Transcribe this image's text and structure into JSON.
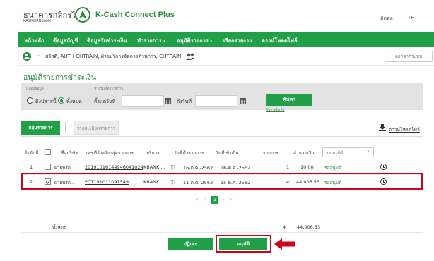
{
  "header": {
    "bank_name": "ธนาคารกสิกรไทย",
    "bank_name_en": "KASIKORNBANK",
    "app_title": "K-Cash Connect Plus",
    "user_short": "ติดต่อ",
    "language": "TH"
  },
  "nav": {
    "items": [
      {
        "label": "หน้าหลัก"
      },
      {
        "label": "ข้อมูลบัญชี"
      },
      {
        "label": "ข้อมูลรับชำระเงิน"
      },
      {
        "label": "ทำรายการ"
      },
      {
        "label": "อนุมัติรายการ"
      },
      {
        "label": "เรียกรายงาน"
      },
      {
        "label": "ดาวน์โหลดไฟล์"
      }
    ],
    "dropdown_caret": "▾"
  },
  "userbar": {
    "caret": "⌄",
    "text": "สวัสดี, AUTH CHTRAIN, ฝ่ายบริการจัดการด้านการ, CHTRAIN",
    "logout_label": "ออกจากระบบ"
  },
  "page_title": "อนุมัติรายการชำระเงิน",
  "filter": {
    "show_label": "แสดงข้อมูล",
    "date_label": "ช่วงวันที่ทำรายการ",
    "radio_option_1": "ดึงปลาสนี้",
    "radio_option_2": "ทั้งหมด",
    "from_date_label": "ตั้งแต่วันที่",
    "to_date_label": "ถึงวันที่",
    "search_label": "ค้นหา",
    "advanced_search_label": "ค้นหาเพิ่มเติม"
  },
  "tabs": {
    "active_label": "กลุ่มรายการ",
    "inactive_label": "รายละเอียดรายการ",
    "download_label": "ดาวน์โหลดไฟล์"
  },
  "table": {
    "headers": {
      "index": "ลำดับที่",
      "company": "ชื่อบริษัท",
      "reference": "เลขที่อ้างอิงกลุ่มรายการ",
      "service": "บริการ",
      "txn_date": "วันที่ทำรายการ",
      "effective_date": "วันที่เข้าเงิน",
      "count": "รายการ",
      "amount": "จำนวนเงิน",
      "status_filter": "รออนุมัติ"
    },
    "rows": [
      {
        "index": "1",
        "company": "ฝ่ายบริก...",
        "reference": "20191016144946041024",
        "service": "KBANK ...",
        "txn_date": "16-ต.ค.-2562",
        "effective_date": "16-ต.ค.-2562",
        "count": "1",
        "amount": "10.00",
        "status": "รออนุมัติ",
        "checked": false
      },
      {
        "index": "2",
        "company": "ฝ่ายบริก...",
        "reference": "PCT191011091549",
        "service": "KBANK ...",
        "txn_date": "11-ต.ค.-2562",
        "effective_date": "15-ต.ค.-2562",
        "count": "4",
        "amount": "44,006.53",
        "status": "รออนุมัติ",
        "checked": true
      }
    ]
  },
  "pagination": {
    "first": "«",
    "prev": "‹",
    "current": "1",
    "next": "›",
    "last": "»"
  },
  "totals": {
    "label": "ทั้งหมด",
    "count": "4",
    "amount": "44,006.53"
  },
  "actions": {
    "reject_label": "ปฏิเสธ",
    "approve_label": "อนุมัติ"
  },
  "colors": {
    "brand_green": "#21a048",
    "highlight_red": "#d0021b"
  }
}
